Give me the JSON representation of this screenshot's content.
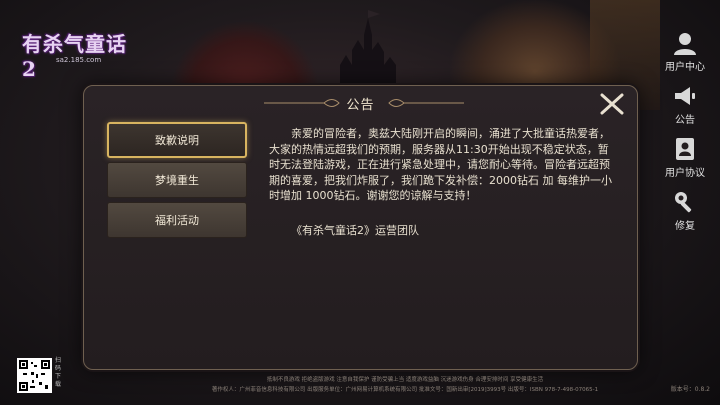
{
  "logo": {
    "title": "有杀气童话2",
    "url": "sa2.185.com"
  },
  "side_menu": [
    {
      "label": "用户中心",
      "icon": "user-icon"
    },
    {
      "label": "公告",
      "icon": "megaphone-icon"
    },
    {
      "label": "用户协议",
      "icon": "user-document-icon"
    },
    {
      "label": "修复",
      "icon": "wrench-icon"
    }
  ],
  "modal": {
    "title": "公告",
    "tabs": [
      {
        "label": "致歉说明",
        "active": true
      },
      {
        "label": "梦境重生",
        "active": false
      },
      {
        "label": "福利活动",
        "active": false
      }
    ],
    "content": {
      "body": "亲爱的冒险者，奥兹大陆刚开启的瞬间，涌进了大批童话热爱者，大家的热情远超我们的预期，服务器从11:30开始出现不稳定状态，暂时无法登陆游戏，正在进行紧急处理中，请您耐心等待。冒险者远超预期的喜爱，把我们炸服了，我们跪下发补偿：2000钻石 加 每维护一小时增加 1000钻石。谢谢您的谅解与支持！",
      "signature": "《有杀气童话2》运营团队"
    }
  },
  "qr_label": "扫码下载",
  "footer": {
    "line1": "抵制不良游戏   拒绝盗版游戏   注意自我保护   谨防受骗上当   适度游戏益脑   沉迷游戏伤身   合理安排时间   享受健康生活",
    "line2": "著作权人：广州菲音信息科技有限公司   出版服务单位：广州网易计算机系统有限公司   批准文号：国新出审[2019]3993号   出版号：ISBN 978-7-498-07065-1"
  },
  "version": "版本号：0.8.2"
}
